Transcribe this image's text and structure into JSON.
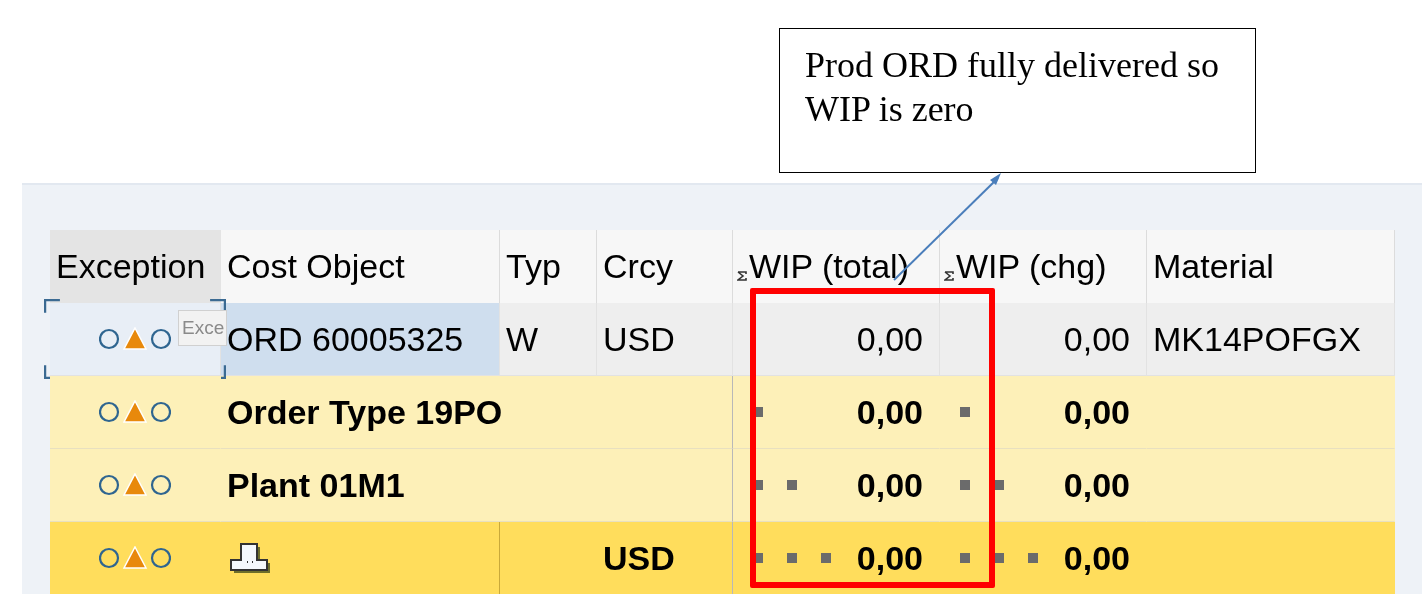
{
  "callout": {
    "text": "Prod ORD fully delivered so WIP is zero"
  },
  "tooltip": {
    "text": "Exce"
  },
  "table": {
    "columns": [
      {
        "label": "Exception",
        "kind": "plain"
      },
      {
        "label": "Cost Object",
        "kind": "plain"
      },
      {
        "label": "Typ",
        "kind": "plain"
      },
      {
        "label": "Crcy",
        "kind": "plain"
      },
      {
        "label": "WIP (total)",
        "kind": "sum"
      },
      {
        "label": "WIP (chg)",
        "kind": "sum"
      },
      {
        "label": "Material",
        "kind": "plain"
      }
    ],
    "rows": [
      {
        "kind": "item",
        "selected": true,
        "cost_object": "ORD 60005325",
        "typ": "W",
        "crcy": "USD",
        "wip_total": "0,00",
        "wip_chg": "0,00",
        "material": "MK14POFGX"
      },
      {
        "kind": "group",
        "selected": false,
        "cost_object": "Order Type 19PO",
        "wip_total": "0,00",
        "wip_chg": "0,00"
      },
      {
        "kind": "subgroup",
        "selected": false,
        "cost_object": "Plant 01M1",
        "wip_total": "0,00",
        "wip_chg": "0,00"
      },
      {
        "kind": "total",
        "selected": false,
        "crcy": "USD",
        "wip_total": "0,00",
        "wip_chg": "0,00"
      }
    ]
  }
}
